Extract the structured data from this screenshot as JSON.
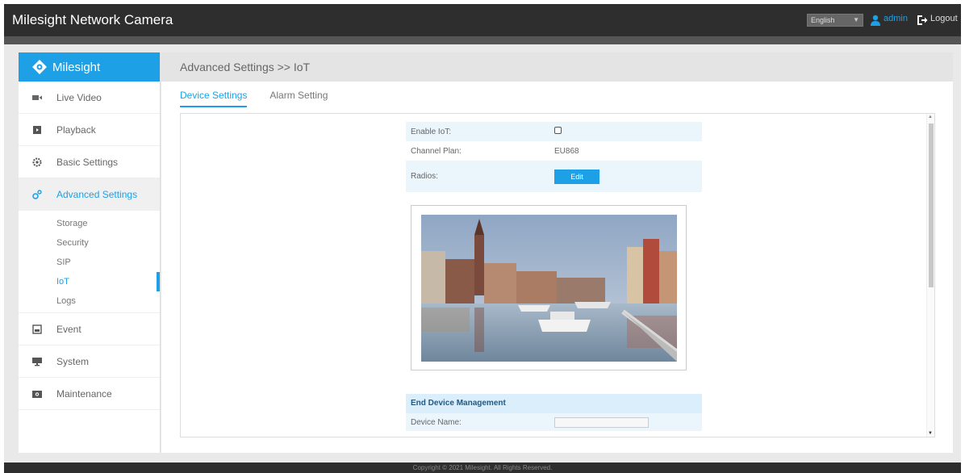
{
  "app": {
    "title": "Milesight Network Camera"
  },
  "header": {
    "language": "English",
    "user": "admin",
    "logout_label": "Logout"
  },
  "sidebar": {
    "logo_text": "Milesight",
    "items": [
      {
        "label": "Live Video",
        "icon": "video-icon"
      },
      {
        "label": "Playback",
        "icon": "playback-icon"
      },
      {
        "label": "Basic Settings",
        "icon": "gear-icon"
      },
      {
        "label": "Advanced Settings",
        "icon": "advanced-gear-icon",
        "active": true
      },
      {
        "label": "Event",
        "icon": "event-icon"
      },
      {
        "label": "System",
        "icon": "monitor-icon"
      },
      {
        "label": "Maintenance",
        "icon": "camera-icon"
      }
    ],
    "sub_items": [
      "Storage",
      "Security",
      "SIP",
      "IoT",
      "Logs"
    ],
    "active_sub": "IoT"
  },
  "main": {
    "breadcrumb": "Advanced Settings >> IoT",
    "tabs": [
      {
        "label": "Device Settings",
        "active": true
      },
      {
        "label": "Alarm Setting",
        "active": false
      }
    ],
    "form": {
      "enable_iot_label": "Enable IoT:",
      "enable_iot_checked": false,
      "channel_plan_label": "Channel Plan:",
      "channel_plan_value": "EU868",
      "radios_label": "Radios:",
      "edit_label": "Edit"
    },
    "end_device": {
      "header": "End Device Management",
      "device_name_label": "Device Name:",
      "device_name_value": ""
    }
  },
  "footer": {
    "copyright": "Copyright © 2021 Milesight. All Rights Reserved."
  },
  "colors": {
    "accent": "#1ea0e6",
    "topbar": "#2e2e2e"
  }
}
